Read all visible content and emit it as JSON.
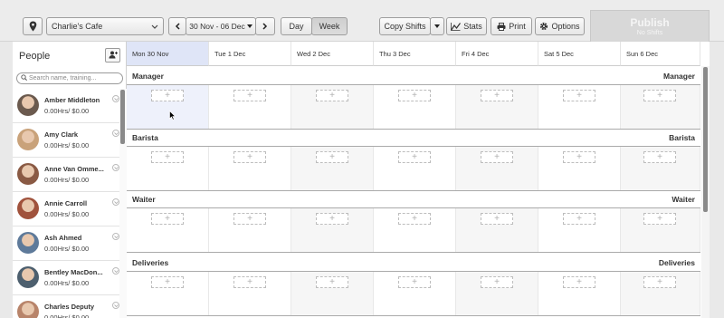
{
  "toolbar": {
    "venue": "Charlie's Cafe",
    "date_range": "30 Nov - 06 Dec",
    "day_label": "Day",
    "week_label": "Week",
    "copy_shifts_label": "Copy Shifts",
    "stats_label": "Stats",
    "print_label": "Print",
    "options_label": "Options"
  },
  "publish": {
    "title": "Publish",
    "subtitle": "No Shifts"
  },
  "people": {
    "title": "People",
    "search_placeholder": "Search name, training...",
    "list": [
      {
        "name": "Amber Middleton",
        "hours": "0.00Hrs/ $0.00",
        "avatar_color": "#6b5a4e"
      },
      {
        "name": "Amy Clark",
        "hours": "0.00Hrs/ $0.00",
        "avatar_color": "#c9a27a"
      },
      {
        "name": "Anne Van Omme...",
        "hours": "0.00Hrs/ $0.00",
        "avatar_color": "#8a5a44"
      },
      {
        "name": "Annie Carroll",
        "hours": "0.00Hrs/ $0.00",
        "avatar_color": "#a0523c"
      },
      {
        "name": "Ash Ahmed",
        "hours": "0.00Hrs/ $0.00",
        "avatar_color": "#5e7a9a"
      },
      {
        "name": "Bentley MacDon...",
        "hours": "0.00Hrs/ $0.00",
        "avatar_color": "#4d5f6e"
      },
      {
        "name": "Charles Deputy",
        "hours": "0.00Hrs/ $0.00",
        "avatar_color": "#b8846a"
      }
    ]
  },
  "days": [
    "Mon 30 Nov",
    "Tue 1 Dec",
    "Wed 2 Dec",
    "Thu 3 Dec",
    "Fri 4 Dec",
    "Sat 5 Dec",
    "Sun 6 Dec"
  ],
  "sections": [
    {
      "name": "Manager"
    },
    {
      "name": "Barista"
    },
    {
      "name": "Waiter"
    },
    {
      "name": "Deliveries"
    }
  ],
  "add_symbol": "+"
}
